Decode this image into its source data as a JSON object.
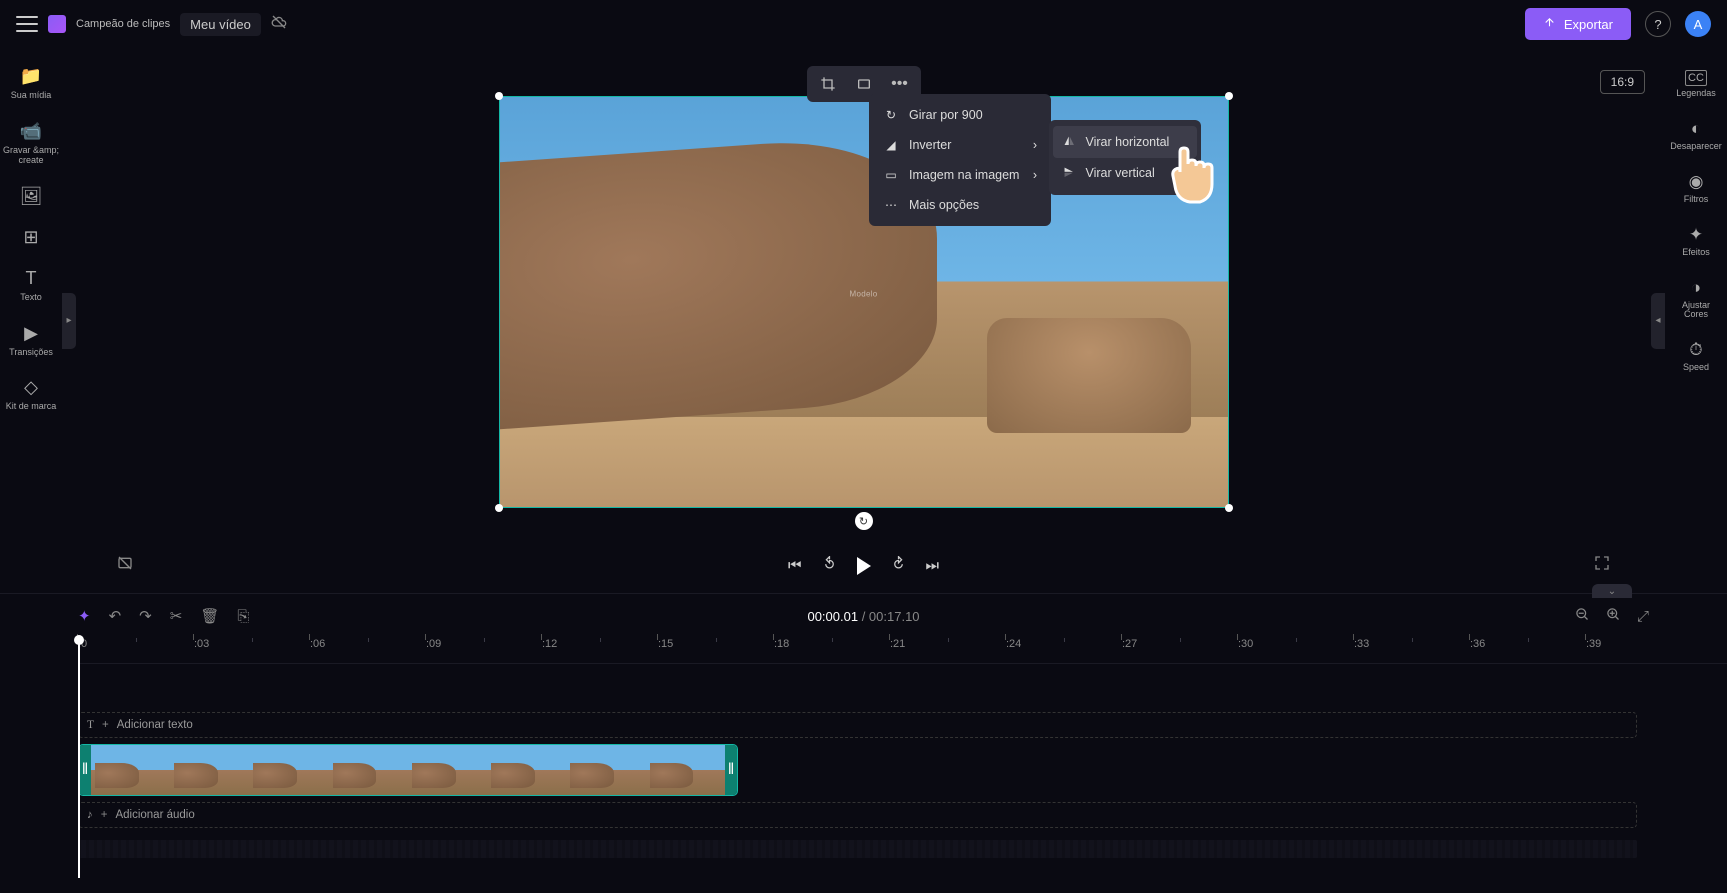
{
  "app": {
    "brand": "Campeão de clipes",
    "video_title": "Meu vídeo"
  },
  "header": {
    "export_label": "Exportar",
    "avatar_letter": "A"
  },
  "left_sidebar": [
    {
      "key": "media",
      "label": "Sua mídia",
      "icon": "📁"
    },
    {
      "key": "record",
      "label": "Gravar &amp;\ncreate",
      "icon": "📹"
    },
    {
      "key": "library",
      "label": "",
      "icon": "🖼"
    },
    {
      "key": "templates",
      "label": "",
      "icon": "⊞"
    },
    {
      "key": "text",
      "label": "Texto",
      "icon": "T"
    },
    {
      "key": "transitions",
      "label": "Transições",
      "icon": "▶"
    },
    {
      "key": "brand",
      "label": "Kit de marca",
      "icon": "◇"
    }
  ],
  "right_sidebar": [
    {
      "key": "captions",
      "label": "Legendas",
      "icon": "CC"
    },
    {
      "key": "fade",
      "label": "Desaparecer",
      "icon": "◐"
    },
    {
      "key": "filters",
      "label": "Filtros",
      "icon": "◉"
    },
    {
      "key": "effects",
      "label": "Efeitos",
      "icon": "✦"
    },
    {
      "key": "adjust",
      "label": "Ajustar\nCores",
      "icon": "◑"
    },
    {
      "key": "speed",
      "label": "Speed",
      "icon": "⏱"
    }
  ],
  "canvas": {
    "aspect_ratio": "16:9",
    "watermark": "Modelo"
  },
  "context_menu": {
    "rotate": "Girar por 900",
    "flip": "Inverter",
    "pip": "Imagem na imagem",
    "more": "Mais opções"
  },
  "flip_submenu": {
    "horizontal": "Virar horizontal",
    "vertical": "Virar vertical"
  },
  "playback": {
    "current_time": "00:00.01",
    "total_time": "00:17.10"
  },
  "timeline": {
    "ticks": [
      ":0",
      ":03",
      ":06",
      ":09",
      ":12",
      ":15",
      ":18",
      ":21",
      ":24",
      ":27",
      ":30",
      ":33",
      ":36",
      ":39"
    ],
    "text_track_label": "Adicionar texto",
    "audio_track_label": "Adicionar áudio"
  }
}
